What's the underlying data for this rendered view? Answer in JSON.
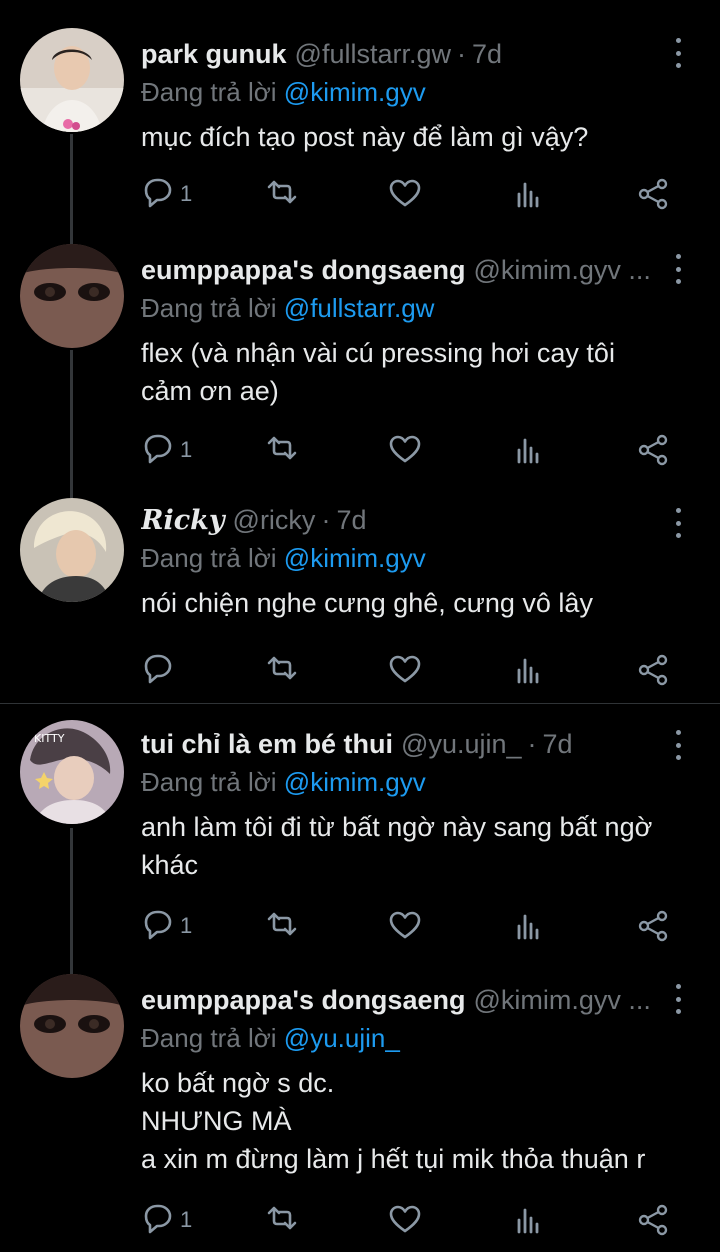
{
  "colors": {
    "background": "#000000",
    "text": "#e7e9ea",
    "muted": "#71767b",
    "mention": "#1d9bf0",
    "icon": "#8b98a5",
    "divider": "#2f3336"
  },
  "reply_prefix": "Đang trả lời",
  "icons": {
    "reply": "reply-icon",
    "retweet": "retweet-icon",
    "like": "like-icon",
    "views": "views-icon",
    "share": "share-icon",
    "more": "more-icon"
  },
  "tweets": [
    {
      "name": "park gunuk",
      "handle": "@fullstarr.gw",
      "time": "7d",
      "reply_to": "@kimim.gyv",
      "text": "mục đích tạo post này để làm gì vậy?",
      "reply_count": "1"
    },
    {
      "name": "eumppappa's dongsaeng",
      "handle": "@kimim.gyv ...",
      "time": "",
      "reply_to": "@fullstarr.gw",
      "text": "flex (và nhận vài cú pressing hơi cay tôi\ncảm ơn ae)",
      "reply_count": "1"
    },
    {
      "name": "Ricky",
      "handle": "@ricky",
      "time": "7d",
      "reply_to": "@kimim.gyv",
      "text": "nói chiện nghe cưng ghê, cưng vô lây",
      "reply_count": ""
    },
    {
      "name": "tui chỉ là em bé thui",
      "handle": "@yu.ujin_",
      "time": "7d",
      "reply_to": "@kimim.gyv",
      "text": "anh làm tôi đi từ bất ngờ này sang bất ngờ\nkhác",
      "reply_count": "1"
    },
    {
      "name": "eumppappa's dongsaeng",
      "handle": "@kimim.gyv ...",
      "time": "",
      "reply_to": "@yu.ujin_",
      "text": "ko bất ngờ s dc.\nNHƯNG MÀ\na xin m đừng làm j hết tụi mik thỏa thuận r",
      "reply_count": "1"
    }
  ]
}
